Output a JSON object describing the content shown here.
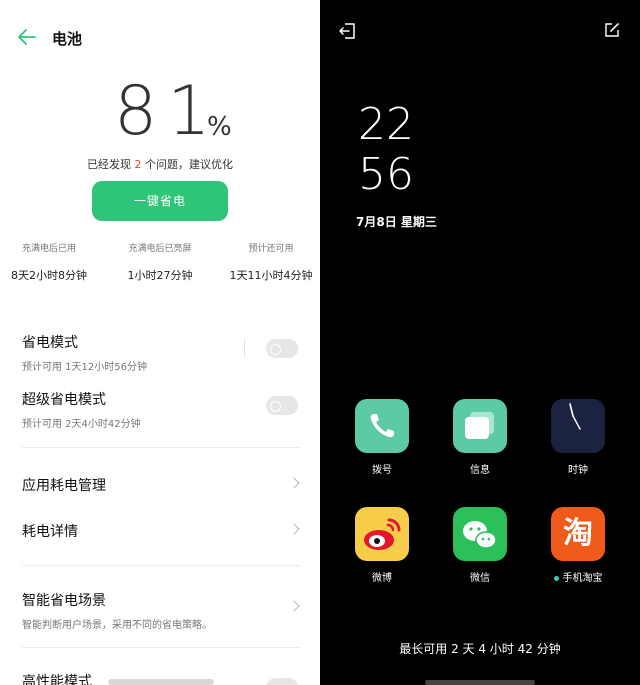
{
  "settings": {
    "title": "电池",
    "percent": "81",
    "percent_symbol": "%",
    "issue_prefix": "已经发现",
    "issue_count": "2",
    "issue_suffix": "个问题，建议优化",
    "one_click_label": "一键省电",
    "stats": [
      {
        "label": "充满电后已用",
        "value": "8天2小时8分钟"
      },
      {
        "label": "充满电后已亮屏",
        "value": "1小时27分钟"
      },
      {
        "label": "预计还可用",
        "value": "1天11小时4分钟"
      }
    ],
    "power_saving": {
      "label": "省电模式",
      "sub": "预计可用 1天12小时56分钟",
      "enabled": false
    },
    "super_saving": {
      "label": "超级省电模式",
      "sub": "预计可用 2天4小时42分钟",
      "enabled": false
    },
    "app_usage": "应用耗电管理",
    "usage_detail": "耗电详情",
    "smart_scene": {
      "label": "智能省电场景",
      "sub": "智能判断用户场景，采用不同的省电策略。"
    },
    "high_perf": "高性能模式"
  },
  "launcher": {
    "time_hour": "22",
    "time_minute": "56",
    "date": "7月8日  星期三",
    "apps": [
      {
        "name": "拨号",
        "icon": "phone-icon"
      },
      {
        "name": "信息",
        "icon": "messages-icon"
      },
      {
        "name": "时钟",
        "icon": "clock-icon"
      },
      {
        "name": "微博",
        "icon": "weibo-icon"
      },
      {
        "name": "微信",
        "icon": "wechat-icon"
      },
      {
        "name": "手机淘宝",
        "icon": "taobao-icon"
      }
    ],
    "taobao_glyph": "淘",
    "longest_usage": "最长可用 2 天 4 小时 42 分钟"
  },
  "colors": {
    "accent_green": "#2fc579",
    "issue_red": "#e0453a",
    "phone_teal": "#5cc9a7",
    "wechat_green": "#2bc05a"
  }
}
